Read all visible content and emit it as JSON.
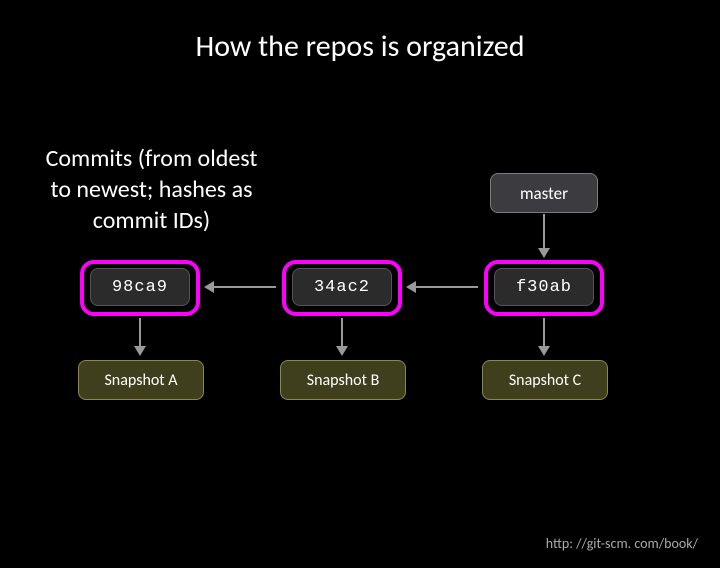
{
  "title": "How the repos is organized",
  "subtitle": "Commits (from oldest to newest; hashes as commit IDs)",
  "master_label": "master",
  "commits": {
    "c1": "98ca9",
    "c2": "34ac2",
    "c3": "f30ab"
  },
  "snapshots": {
    "s1": "Snapshot A",
    "s2": "Snapshot B",
    "s3": "Snapshot C"
  },
  "footer": "http: //git-scm. com/book/"
}
